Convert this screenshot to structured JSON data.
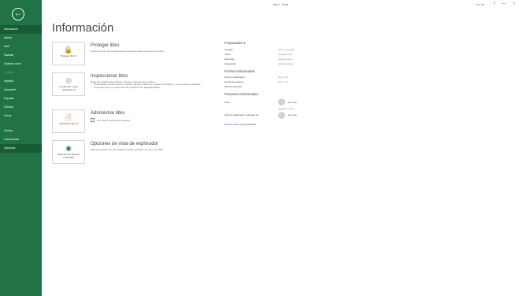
{
  "window": {
    "title": "Libro1 - Excel",
    "user": "Ivo, ioo",
    "help": "?",
    "minimize": "—",
    "restore": "□"
  },
  "nav": {
    "back": "←",
    "items": [
      {
        "label": "Información",
        "state": "selected"
      },
      {
        "label": "Nuevo",
        "state": "normal"
      },
      {
        "label": "Abrir",
        "state": "normal"
      },
      {
        "label": "Guardar",
        "state": "normal"
      },
      {
        "label": "Guardar como",
        "state": "normal"
      },
      {
        "label": "Historial",
        "state": "disabled"
      },
      {
        "label": "Imprimir",
        "state": "normal"
      },
      {
        "label": "Compartir",
        "state": "normal"
      },
      {
        "label": "Exportar",
        "state": "normal"
      },
      {
        "label": "Publicar",
        "state": "normal"
      },
      {
        "label": "Cerrar",
        "state": "normal"
      },
      {
        "label": "Cuenta",
        "state": "normal"
      },
      {
        "label": "Comentarios",
        "state": "normal"
      },
      {
        "label": "Opciones",
        "state": "normal"
      }
    ]
  },
  "page": {
    "title": "Información"
  },
  "sections": {
    "protect": {
      "tile_label": "Proteger libro ▾",
      "title": "Proteger libro",
      "desc": "Controle el tipo de cambios que los demás pueden hacer en este libro."
    },
    "inspect": {
      "tile_label": "Comprobar si hay problemas ▾",
      "title": "Inspeccionar libro",
      "desc": "Antes de publicar este archivo, tenga en cuenta que contiene:",
      "bullets": [
        "Propiedades del documento, nombre del autor, datos de imagen recortados y ruta de acceso absoluta",
        "Contenido que no pueden leer los usuarios con discapacidades"
      ]
    },
    "manage": {
      "tile_label": "Administrar libro ▾",
      "title": "Administrar libro",
      "check": "No existen cambios sin guardar."
    },
    "browser": {
      "tile_label": "Opciones de vista de explorador",
      "title": "Opciones de vista de explorador",
      "desc": "Elija qué pueden ver los usuarios cuando este libro se vea en la Web."
    }
  },
  "properties": {
    "header": "Propiedades ▾",
    "rows": [
      {
        "label": "Tamaño",
        "value": "Aún no se guar..."
      },
      {
        "label": "Título",
        "value": "Agregar título"
      },
      {
        "label": "Etiquetas",
        "value": "Agregar etiqu..."
      },
      {
        "label": "Categorías",
        "value": "Agregar categ..."
      }
    ],
    "dates_header": "Fechas relacionadas",
    "dates": [
      {
        "label": "Última modificación",
        "value": "Hoy, 3:29"
      },
      {
        "label": "Fecha de creación",
        "value": "Hoy, 3:14"
      },
      {
        "label": "Última impresión",
        "value": ""
      }
    ],
    "people_header": "Personas relacionadas",
    "author_label": "Autor",
    "author_name": "ELuedlo",
    "add_author": "Agregar un aut...",
    "modified_by_label": "Última modificación realizada por",
    "modified_by_name": "ELuedlo",
    "show_all": "Mostrar todas las propiedades"
  }
}
